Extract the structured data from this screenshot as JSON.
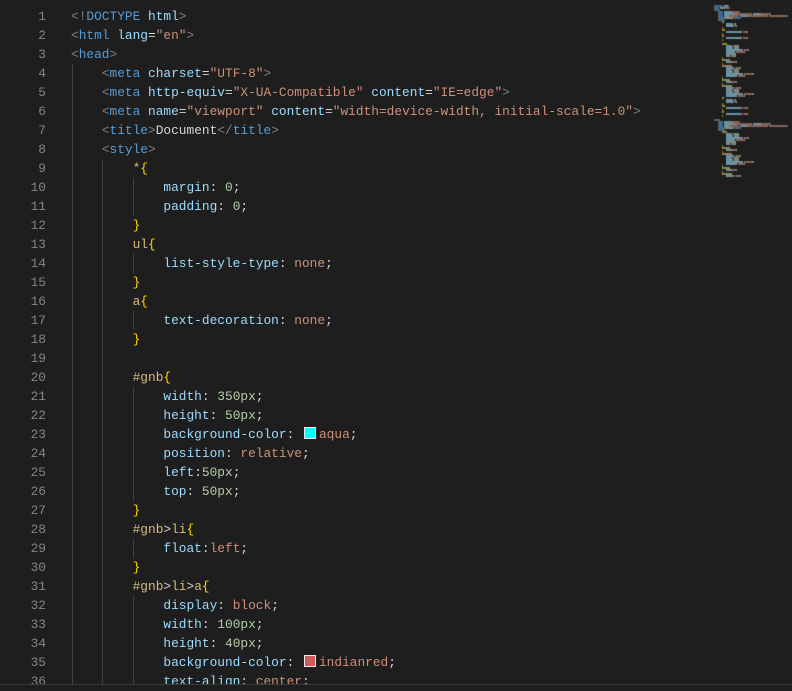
{
  "editor": {
    "theme": {
      "bg": "#1e1e1e",
      "ln": "#858585",
      "guide": "#404040",
      "punct": "#808080",
      "tag": "#569cd6",
      "attr": "#9cdcfe",
      "str": "#ce9178",
      "plain": "#d4d4d4",
      "sel": "#d7ba7d",
      "brace": "#ffd700",
      "prop": "#9cdcfe",
      "num": "#b5cea8",
      "val": "#ce9178"
    },
    "lines": [
      {
        "n": 1,
        "tokens": [
          [
            "punct",
            "<!"
          ],
          [
            "tag",
            "DOCTYPE"
          ],
          [
            "plain",
            " "
          ],
          [
            "attr",
            "html"
          ],
          [
            "punct",
            ">"
          ]
        ]
      },
      {
        "n": 2,
        "tokens": [
          [
            "punct",
            "<"
          ],
          [
            "tag",
            "html"
          ],
          [
            "plain",
            " "
          ],
          [
            "attr",
            "lang"
          ],
          [
            "plain",
            "="
          ],
          [
            "str",
            "\"en\""
          ],
          [
            "punct",
            ">"
          ]
        ]
      },
      {
        "n": 3,
        "tokens": [
          [
            "punct",
            "<"
          ],
          [
            "tag",
            "head"
          ],
          [
            "punct",
            ">"
          ]
        ]
      },
      {
        "n": 4,
        "tokens": [
          [
            "ws",
            "    "
          ],
          [
            "punct",
            "<"
          ],
          [
            "tag",
            "meta"
          ],
          [
            "plain",
            " "
          ],
          [
            "attr",
            "charset"
          ],
          [
            "plain",
            "="
          ],
          [
            "str",
            "\"UTF-8\""
          ],
          [
            "punct",
            ">"
          ]
        ]
      },
      {
        "n": 5,
        "tokens": [
          [
            "ws",
            "    "
          ],
          [
            "punct",
            "<"
          ],
          [
            "tag",
            "meta"
          ],
          [
            "plain",
            " "
          ],
          [
            "attr",
            "http-equiv"
          ],
          [
            "plain",
            "="
          ],
          [
            "str",
            "\"X-UA-Compatible\""
          ],
          [
            "plain",
            " "
          ],
          [
            "attr",
            "content"
          ],
          [
            "plain",
            "="
          ],
          [
            "str",
            "\"IE=edge\""
          ],
          [
            "punct",
            ">"
          ]
        ]
      },
      {
        "n": 6,
        "tokens": [
          [
            "ws",
            "    "
          ],
          [
            "punct",
            "<"
          ],
          [
            "tag",
            "meta"
          ],
          [
            "plain",
            " "
          ],
          [
            "attr",
            "name"
          ],
          [
            "plain",
            "="
          ],
          [
            "str",
            "\"viewport\""
          ],
          [
            "plain",
            " "
          ],
          [
            "attr",
            "content"
          ],
          [
            "plain",
            "="
          ],
          [
            "str",
            "\"width=device-width, initial-scale=1.0\""
          ],
          [
            "punct",
            ">"
          ]
        ]
      },
      {
        "n": 7,
        "tokens": [
          [
            "ws",
            "    "
          ],
          [
            "punct",
            "<"
          ],
          [
            "tag",
            "title"
          ],
          [
            "punct",
            ">"
          ],
          [
            "plain",
            "Document"
          ],
          [
            "punct",
            "</"
          ],
          [
            "tag",
            "title"
          ],
          [
            "punct",
            ">"
          ]
        ]
      },
      {
        "n": 8,
        "tokens": [
          [
            "ws",
            "    "
          ],
          [
            "punct",
            "<"
          ],
          [
            "tag",
            "style"
          ],
          [
            "punct",
            ">"
          ]
        ]
      },
      {
        "n": 9,
        "tokens": [
          [
            "ws",
            "        "
          ],
          [
            "sel",
            "*"
          ],
          [
            "brace",
            "{"
          ]
        ]
      },
      {
        "n": 10,
        "tokens": [
          [
            "ws",
            "            "
          ],
          [
            "prop",
            "margin"
          ],
          [
            "plain",
            ": "
          ],
          [
            "num",
            "0"
          ],
          [
            "plain",
            ";"
          ]
        ]
      },
      {
        "n": 11,
        "tokens": [
          [
            "ws",
            "            "
          ],
          [
            "prop",
            "padding"
          ],
          [
            "plain",
            ": "
          ],
          [
            "num",
            "0"
          ],
          [
            "plain",
            ";"
          ]
        ]
      },
      {
        "n": 12,
        "tokens": [
          [
            "ws",
            "        "
          ],
          [
            "brace",
            "}"
          ]
        ]
      },
      {
        "n": 13,
        "tokens": [
          [
            "ws",
            "        "
          ],
          [
            "sel",
            "ul"
          ],
          [
            "brace",
            "{"
          ]
        ]
      },
      {
        "n": 14,
        "tokens": [
          [
            "ws",
            "            "
          ],
          [
            "prop",
            "list-style-type"
          ],
          [
            "plain",
            ": "
          ],
          [
            "val",
            "none"
          ],
          [
            "plain",
            ";"
          ]
        ]
      },
      {
        "n": 15,
        "tokens": [
          [
            "ws",
            "        "
          ],
          [
            "brace",
            "}"
          ]
        ]
      },
      {
        "n": 16,
        "tokens": [
          [
            "ws",
            "        "
          ],
          [
            "sel",
            "a"
          ],
          [
            "brace",
            "{"
          ]
        ]
      },
      {
        "n": 17,
        "tokens": [
          [
            "ws",
            "            "
          ],
          [
            "prop",
            "text-decoration"
          ],
          [
            "plain",
            ": "
          ],
          [
            "val",
            "none"
          ],
          [
            "plain",
            ";"
          ]
        ]
      },
      {
        "n": 18,
        "tokens": [
          [
            "ws",
            "        "
          ],
          [
            "brace",
            "}"
          ]
        ]
      },
      {
        "n": 19,
        "tokens": []
      },
      {
        "n": 20,
        "tokens": [
          [
            "ws",
            "        "
          ],
          [
            "sel",
            "#gnb"
          ],
          [
            "brace",
            "{"
          ]
        ]
      },
      {
        "n": 21,
        "tokens": [
          [
            "ws",
            "            "
          ],
          [
            "prop",
            "width"
          ],
          [
            "plain",
            ": "
          ],
          [
            "num",
            "350px"
          ],
          [
            "plain",
            ";"
          ]
        ]
      },
      {
        "n": 22,
        "tokens": [
          [
            "ws",
            "            "
          ],
          [
            "prop",
            "height"
          ],
          [
            "plain",
            ": "
          ],
          [
            "num",
            "50px"
          ],
          [
            "plain",
            ";"
          ]
        ]
      },
      {
        "n": 23,
        "tokens": [
          [
            "ws",
            "            "
          ],
          [
            "prop",
            "background-color"
          ],
          [
            "plain",
            ": "
          ],
          [
            "swatch",
            "#00ffff"
          ],
          [
            "val",
            "aqua"
          ],
          [
            "plain",
            ";"
          ]
        ]
      },
      {
        "n": 24,
        "tokens": [
          [
            "ws",
            "            "
          ],
          [
            "prop",
            "position"
          ],
          [
            "plain",
            ": "
          ],
          [
            "val",
            "relative"
          ],
          [
            "plain",
            ";"
          ]
        ]
      },
      {
        "n": 25,
        "tokens": [
          [
            "ws",
            "            "
          ],
          [
            "prop",
            "left"
          ],
          [
            "plain",
            ":"
          ],
          [
            "num",
            "50px"
          ],
          [
            "plain",
            ";"
          ]
        ]
      },
      {
        "n": 26,
        "tokens": [
          [
            "ws",
            "            "
          ],
          [
            "prop",
            "top"
          ],
          [
            "plain",
            ": "
          ],
          [
            "num",
            "50px"
          ],
          [
            "plain",
            ";"
          ]
        ]
      },
      {
        "n": 27,
        "tokens": [
          [
            "ws",
            "        "
          ],
          [
            "brace",
            "}"
          ]
        ]
      },
      {
        "n": 28,
        "tokens": [
          [
            "ws",
            "        "
          ],
          [
            "sel",
            "#gnb"
          ],
          [
            "plain",
            ">"
          ],
          [
            "sel",
            "li"
          ],
          [
            "brace",
            "{"
          ]
        ]
      },
      {
        "n": 29,
        "tokens": [
          [
            "ws",
            "            "
          ],
          [
            "prop",
            "float"
          ],
          [
            "plain",
            ":"
          ],
          [
            "val",
            "left"
          ],
          [
            "plain",
            ";"
          ]
        ]
      },
      {
        "n": 30,
        "tokens": [
          [
            "ws",
            "        "
          ],
          [
            "brace",
            "}"
          ]
        ]
      },
      {
        "n": 31,
        "tokens": [
          [
            "ws",
            "        "
          ],
          [
            "sel",
            "#gnb"
          ],
          [
            "plain",
            ">"
          ],
          [
            "sel",
            "li"
          ],
          [
            "plain",
            ">"
          ],
          [
            "sel",
            "a"
          ],
          [
            "brace",
            "{"
          ]
        ]
      },
      {
        "n": 32,
        "tokens": [
          [
            "ws",
            "            "
          ],
          [
            "prop",
            "display"
          ],
          [
            "plain",
            ": "
          ],
          [
            "val",
            "block"
          ],
          [
            "plain",
            ";"
          ]
        ]
      },
      {
        "n": 33,
        "tokens": [
          [
            "ws",
            "            "
          ],
          [
            "prop",
            "width"
          ],
          [
            "plain",
            ": "
          ],
          [
            "num",
            "100px"
          ],
          [
            "plain",
            ";"
          ]
        ]
      },
      {
        "n": 34,
        "tokens": [
          [
            "ws",
            "            "
          ],
          [
            "prop",
            "height"
          ],
          [
            "plain",
            ": "
          ],
          [
            "num",
            "40px"
          ],
          [
            "plain",
            ";"
          ]
        ]
      },
      {
        "n": 35,
        "tokens": [
          [
            "ws",
            "            "
          ],
          [
            "prop",
            "background-color"
          ],
          [
            "plain",
            ": "
          ],
          [
            "swatch",
            "#cd5c5c"
          ],
          [
            "val",
            "indianred"
          ],
          [
            "plain",
            ";"
          ]
        ]
      },
      {
        "n": 36,
        "tokens": [
          [
            "ws",
            "            "
          ],
          [
            "prop",
            "text-align"
          ],
          [
            "plain",
            ": "
          ],
          [
            "val",
            "center"
          ],
          [
            "plain",
            ";"
          ]
        ]
      }
    ]
  }
}
